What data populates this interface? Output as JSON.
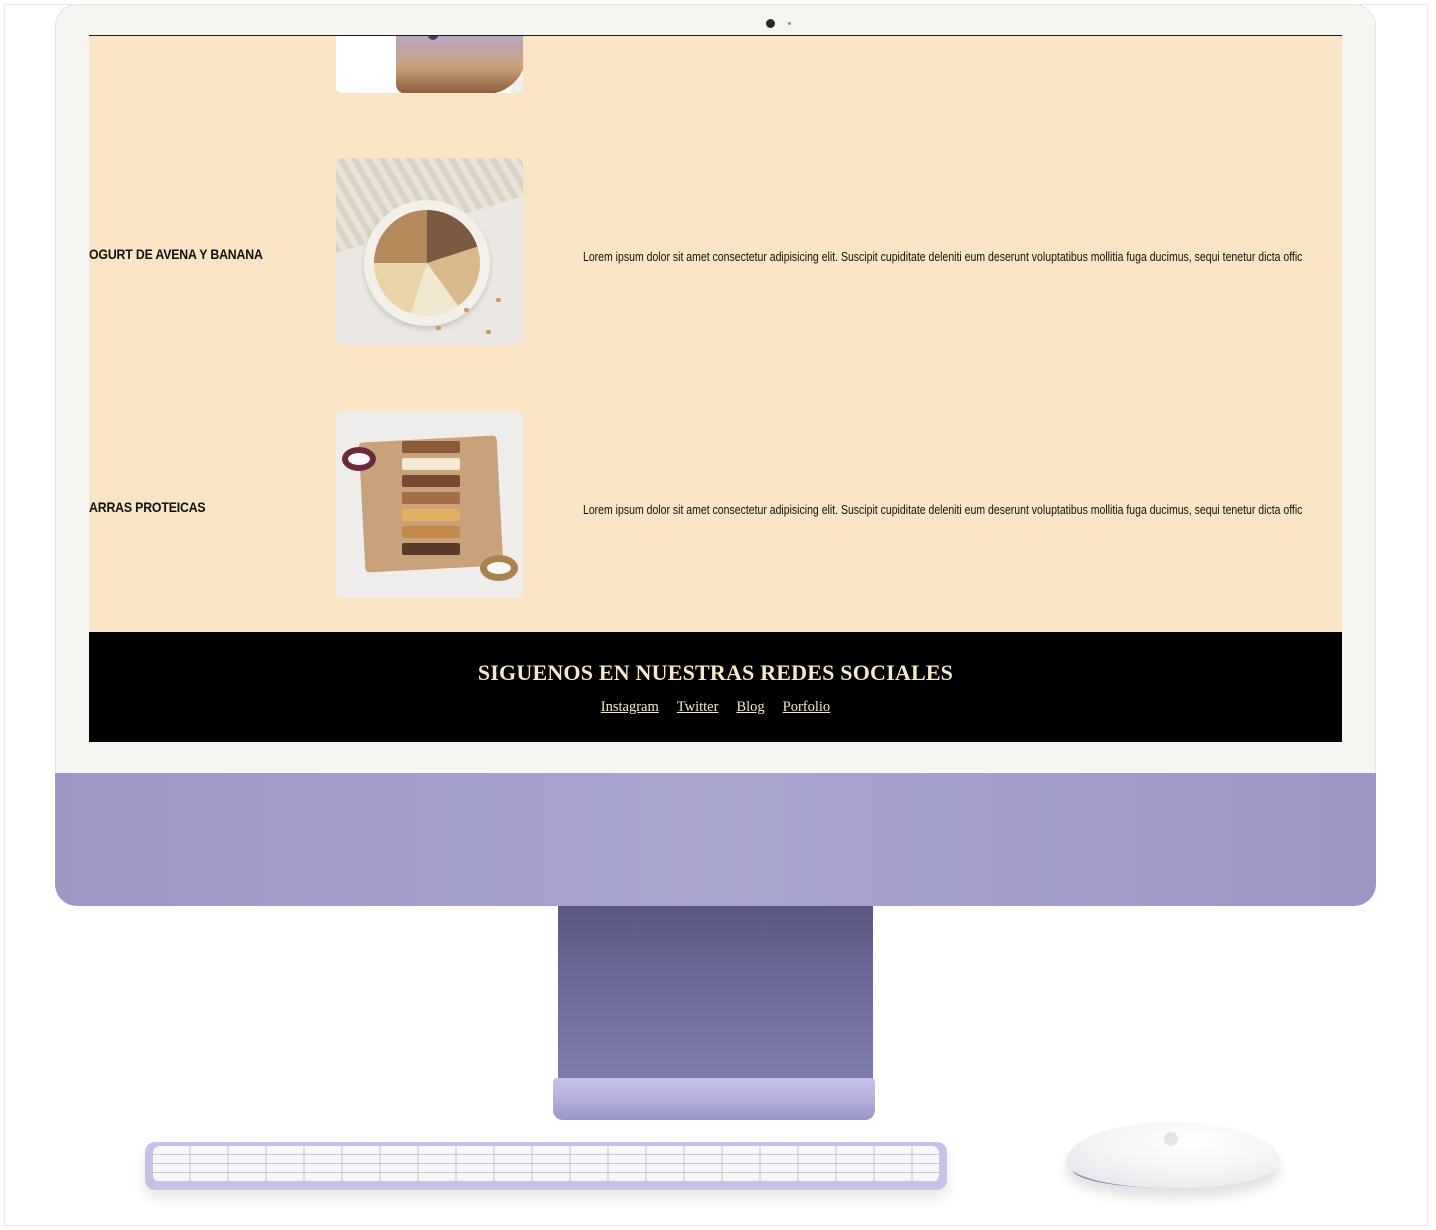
{
  "page": {
    "products": [
      {
        "title": "",
        "description": ""
      },
      {
        "title": "OGURT DE AVENA Y BANANA",
        "description": "Lorem ipsum dolor sit amet consectetur adipisicing elit. Suscipit cupiditate deleniti eum deserunt voluptatibus mollitia fuga ducimus, sequi tenetur dicta offic"
      },
      {
        "title": "ARRAS PROTEICAS",
        "description": "Lorem ipsum dolor sit amet consectetur adipisicing elit. Suscipit cupiditate deleniti eum deserunt voluptatibus mollitia fuga ducimus, sequi tenetur dicta offic"
      }
    ],
    "footer": {
      "title": "SIGUENOS EN NUESTRAS REDES SOCIALES",
      "links": [
        "Instagram",
        "Twitter",
        "Blog",
        "Porfolio"
      ]
    }
  },
  "colors": {
    "page_background": "#fae4c6",
    "footer_background": "#000000",
    "footer_text": "#f7e6c9",
    "device_accent": "#a8a5cf"
  }
}
